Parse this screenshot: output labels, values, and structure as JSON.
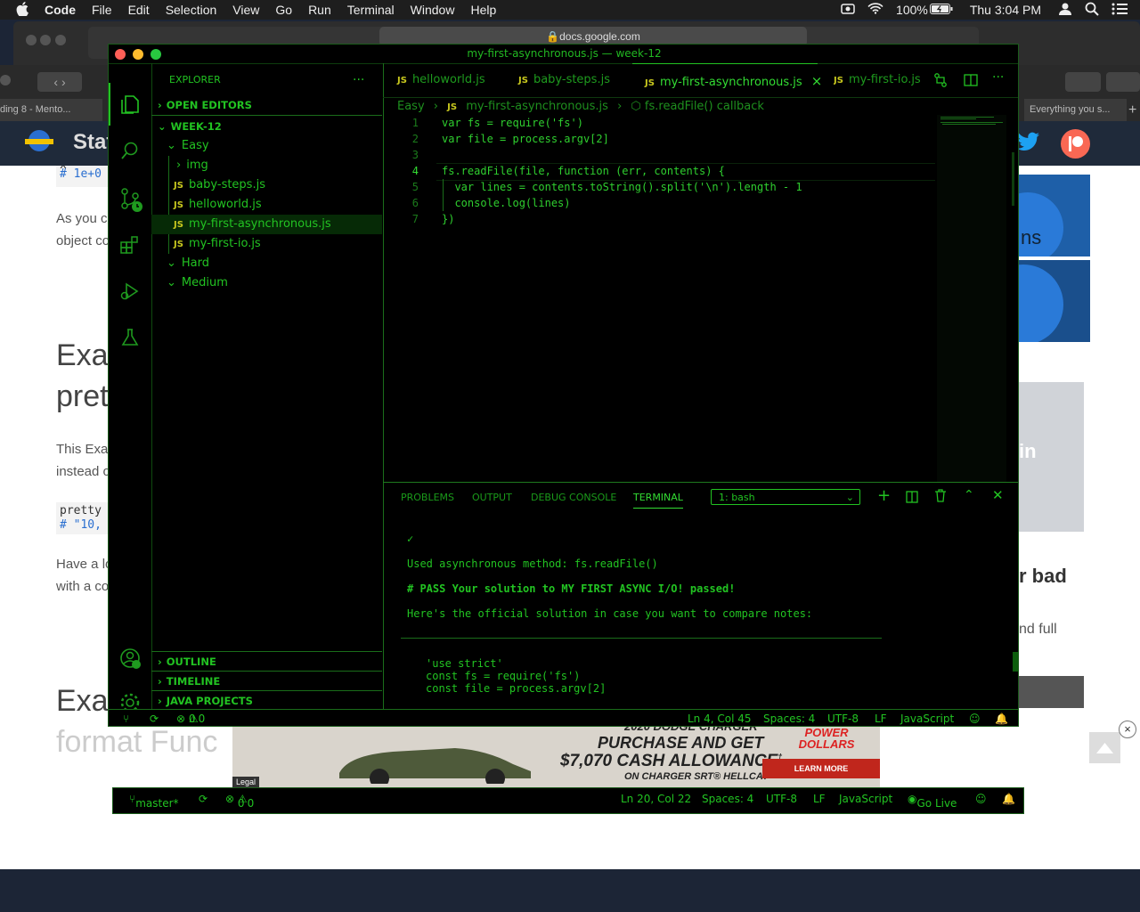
{
  "menubar": {
    "apple": "",
    "app": "Code",
    "items": [
      "File",
      "Edit",
      "Selection",
      "View",
      "Go",
      "Run",
      "Terminal",
      "Window",
      "Help"
    ],
    "battery": "100%",
    "clock": "Thu 3:04 PM"
  },
  "browser": {
    "url": "docs.google.com",
    "left_tab": "ding 8 - Mento...",
    "right_tab": "Everything you s...",
    "site_title": "Stat"
  },
  "webpage": {
    "code1a": "x",
    "code1b": "# 1e+0",
    "p1a": "As you c",
    "p1b": "object co",
    "h1a": "Exa",
    "h1b": "pret",
    "p2a": "This Exa",
    "p2b": "instead o",
    "code2a": "pretty",
    "code2b": "# \"10,",
    "p3a": "Have a lo",
    "p3b": "with a co",
    "right1": "ns",
    "right2": "in",
    "right3": "r bad",
    "right4": "nd full",
    "h2a": "Exa",
    "h2b": "format Func"
  },
  "ad": {
    "line1": "2020 DODGE CHARGER",
    "line2": "PURCHASE AND GET",
    "line3": "$7,070 CASH ALLOWANCE",
    "line3_sup": "†",
    "line4": "ON CHARGER SRT® HELLCAT",
    "badge": "POWER DOLLARS",
    "cta": "LEARN MORE",
    "legal": "Legal",
    "close": "×"
  },
  "vscode": {
    "title": "my-first-asynchronous.js — week-12",
    "explorer_label": "EXPLORER",
    "open_editors": "OPEN EDITORS",
    "workspace": "WEEK-12",
    "tree": [
      {
        "label": "Easy",
        "type": "folder-open",
        "indent": 1
      },
      {
        "label": "img",
        "type": "folder-closed",
        "indent": 2
      },
      {
        "label": "baby-steps.js",
        "type": "js",
        "indent": 2
      },
      {
        "label": "helloworld.js",
        "type": "js",
        "indent": 2
      },
      {
        "label": "my-first-asynchronous.js",
        "type": "js",
        "indent": 2,
        "selected": true
      },
      {
        "label": "my-first-io.js",
        "type": "js",
        "indent": 2
      },
      {
        "label": "Hard",
        "type": "folder-open",
        "indent": 1
      },
      {
        "label": "Medium",
        "type": "folder-open",
        "indent": 1
      }
    ],
    "outline": "OUTLINE",
    "timeline": "TIMELINE",
    "java_projects": "JAVA PROJECTS",
    "tabs": [
      {
        "label": "helloworld.js",
        "active": false
      },
      {
        "label": "baby-steps.js",
        "active": false
      },
      {
        "label": "my-first-asynchronous.js",
        "active": true
      },
      {
        "label": "my-first-io.js",
        "active": false
      }
    ],
    "tab_close": "×",
    "js_badge": "JS",
    "breadcrumb": [
      "Easy",
      "my-first-asynchronous.js",
      "fs.readFile() callback"
    ],
    "code_lines": [
      "var fs = require('fs')",
      "var file = process.argv[2]",
      "",
      "fs.readFile(file, function (err, contents) {",
      "  var lines = contents.toString().split('\\n').length - 1",
      "  console.log(lines)",
      "})"
    ],
    "panel_tabs": [
      "PROBLEMS",
      "OUTPUT",
      "DEBUG CONSOLE",
      "TERMINAL"
    ],
    "terminal_select": "1: bash",
    "terminal_lines": [
      "✓",
      "Used asynchronous method: fs.readFile()",
      "# PASS Your solution to MY FIRST ASYNC I/O! passed!",
      "Here's the official solution in case you want to compare notes:",
      "'use strict'",
      "const fs = require('fs')",
      "const file = process.argv[2]"
    ],
    "status": {
      "errors": "0",
      "warnings": "0",
      "position": "Ln 4, Col 45",
      "spaces": "Spaces: 4",
      "encoding": "UTF-8",
      "eol": "LF",
      "language": "JavaScript"
    }
  },
  "back_vscode": {
    "branch": "master*",
    "errors": "0",
    "warnings": "0",
    "position": "Ln 20, Col 22",
    "spaces": "Spaces: 4",
    "encoding": "UTF-8",
    "eol": "LF",
    "language": "JavaScript",
    "golive": "Go Live"
  },
  "colors": {
    "accent": "#22c322",
    "background": "#000000",
    "keyword": "#3ad13a"
  }
}
